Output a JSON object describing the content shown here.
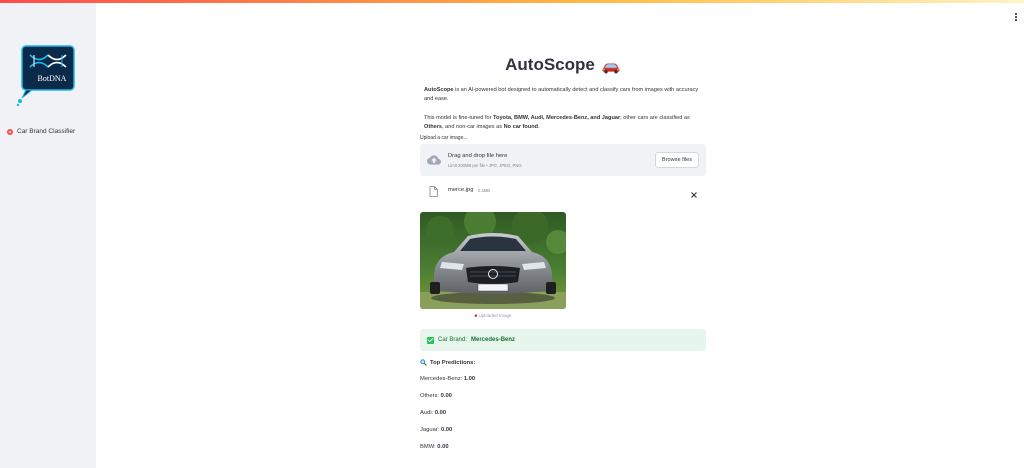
{
  "sidebar": {
    "logo_text": "BotDNA",
    "nav_items": [
      {
        "label": "Car Brand Classifier",
        "active": true
      }
    ]
  },
  "header": {
    "menu_icon": "vertical-ellipsis-icon"
  },
  "main": {
    "title": "AutoScope",
    "title_icon": "car-emoji-icon",
    "intro": {
      "brand": "AutoScope",
      "text": " is an AI-powered bot designed to automatically detect and classify cars from images with accuracy and ease."
    },
    "model_info": {
      "prefix": "This model is fine-tuned for ",
      "brands": "Toyota, BMW, Audi, Mercedes-Benz, and Jaguar",
      "middle": "; other cars are classified as ",
      "others": "Others",
      "middle2": ", and non-car images as ",
      "nocar": "No car found",
      "end": "."
    },
    "uploader": {
      "label": "Upload a car image...",
      "drag_text": "Drag and drop file here",
      "limit_text": "Limit 200MB per file • JPG, JPEG, PNG",
      "browse_label": "Browse files"
    },
    "file": {
      "name": "merce.jpg",
      "size": "0.4MB"
    },
    "image_caption": "Uploaded Image",
    "result": {
      "label": "Car Brand: ",
      "value": "Mercedes-Benz"
    },
    "predictions_title": "Top Predictions:",
    "predictions": [
      {
        "label": "Mercedes-Benz: ",
        "value": "1.00"
      },
      {
        "label": "Others: ",
        "value": "0.00"
      },
      {
        "label": "Audi: ",
        "value": "0.00"
      },
      {
        "label": "Jaguar: ",
        "value": "0.00"
      },
      {
        "label": "BMW: ",
        "value": "0.00"
      }
    ]
  },
  "colors": {
    "accent": "#ff4b4b",
    "success_bg": "#e6f6ec",
    "success_text": "#177233",
    "sidebar_bg": "#f0f2f6"
  }
}
